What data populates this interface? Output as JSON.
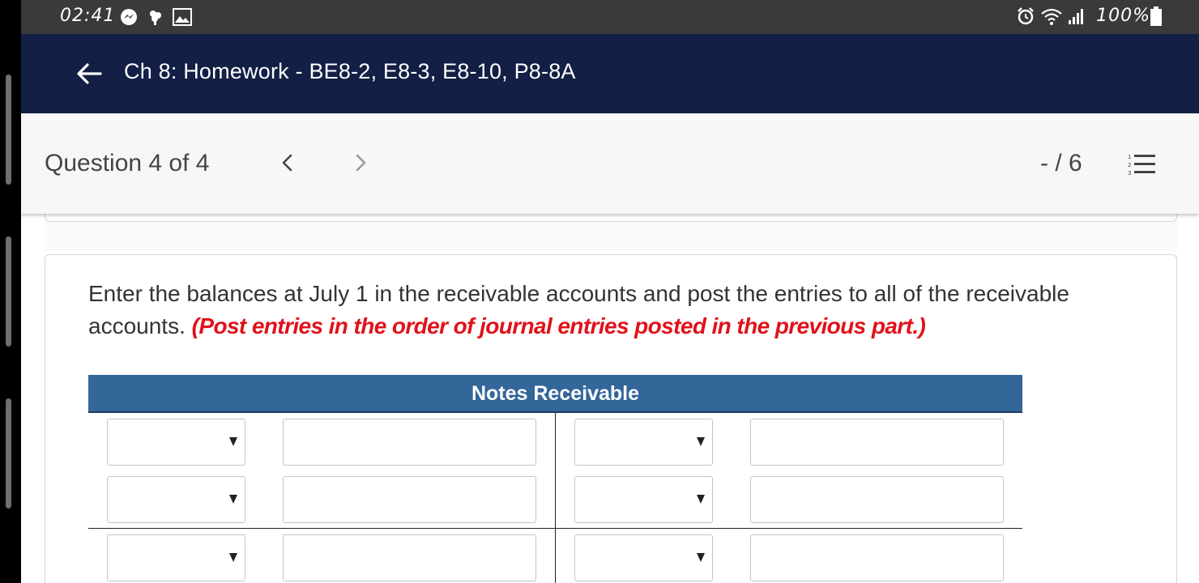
{
  "status_bar": {
    "time": "02:41",
    "battery": "100%",
    "left_icons": [
      "messenger-icon",
      "tree-icon",
      "gallery-icon"
    ],
    "right_icons": [
      "alarm-icon",
      "wifi-icon",
      "signal-icon",
      "battery-icon"
    ]
  },
  "header": {
    "title": "Ch 8: Homework - BE8-2, E8-3, E8-10, P8-8A",
    "background": "#131f45"
  },
  "question_nav": {
    "label": "Question 4 of 4",
    "score": "- / 6"
  },
  "question": {
    "instruction": "Enter the balances at July 1 in the receivable accounts and post the entries to all of the receivable accounts.",
    "emphasis": "(Post entries in the order of journal entries posted in the previous part.)",
    "emphasis_color": "#e0121a"
  },
  "t_account": {
    "title": "Notes Receivable",
    "header_color": "#336699",
    "rows": [
      {
        "left_select": "",
        "left_amount": "",
        "right_select": "",
        "right_amount": ""
      },
      {
        "left_select": "",
        "left_amount": "",
        "right_select": "",
        "right_amount": ""
      },
      {
        "left_select": "",
        "left_amount": "",
        "right_select": "",
        "right_amount": ""
      }
    ]
  }
}
